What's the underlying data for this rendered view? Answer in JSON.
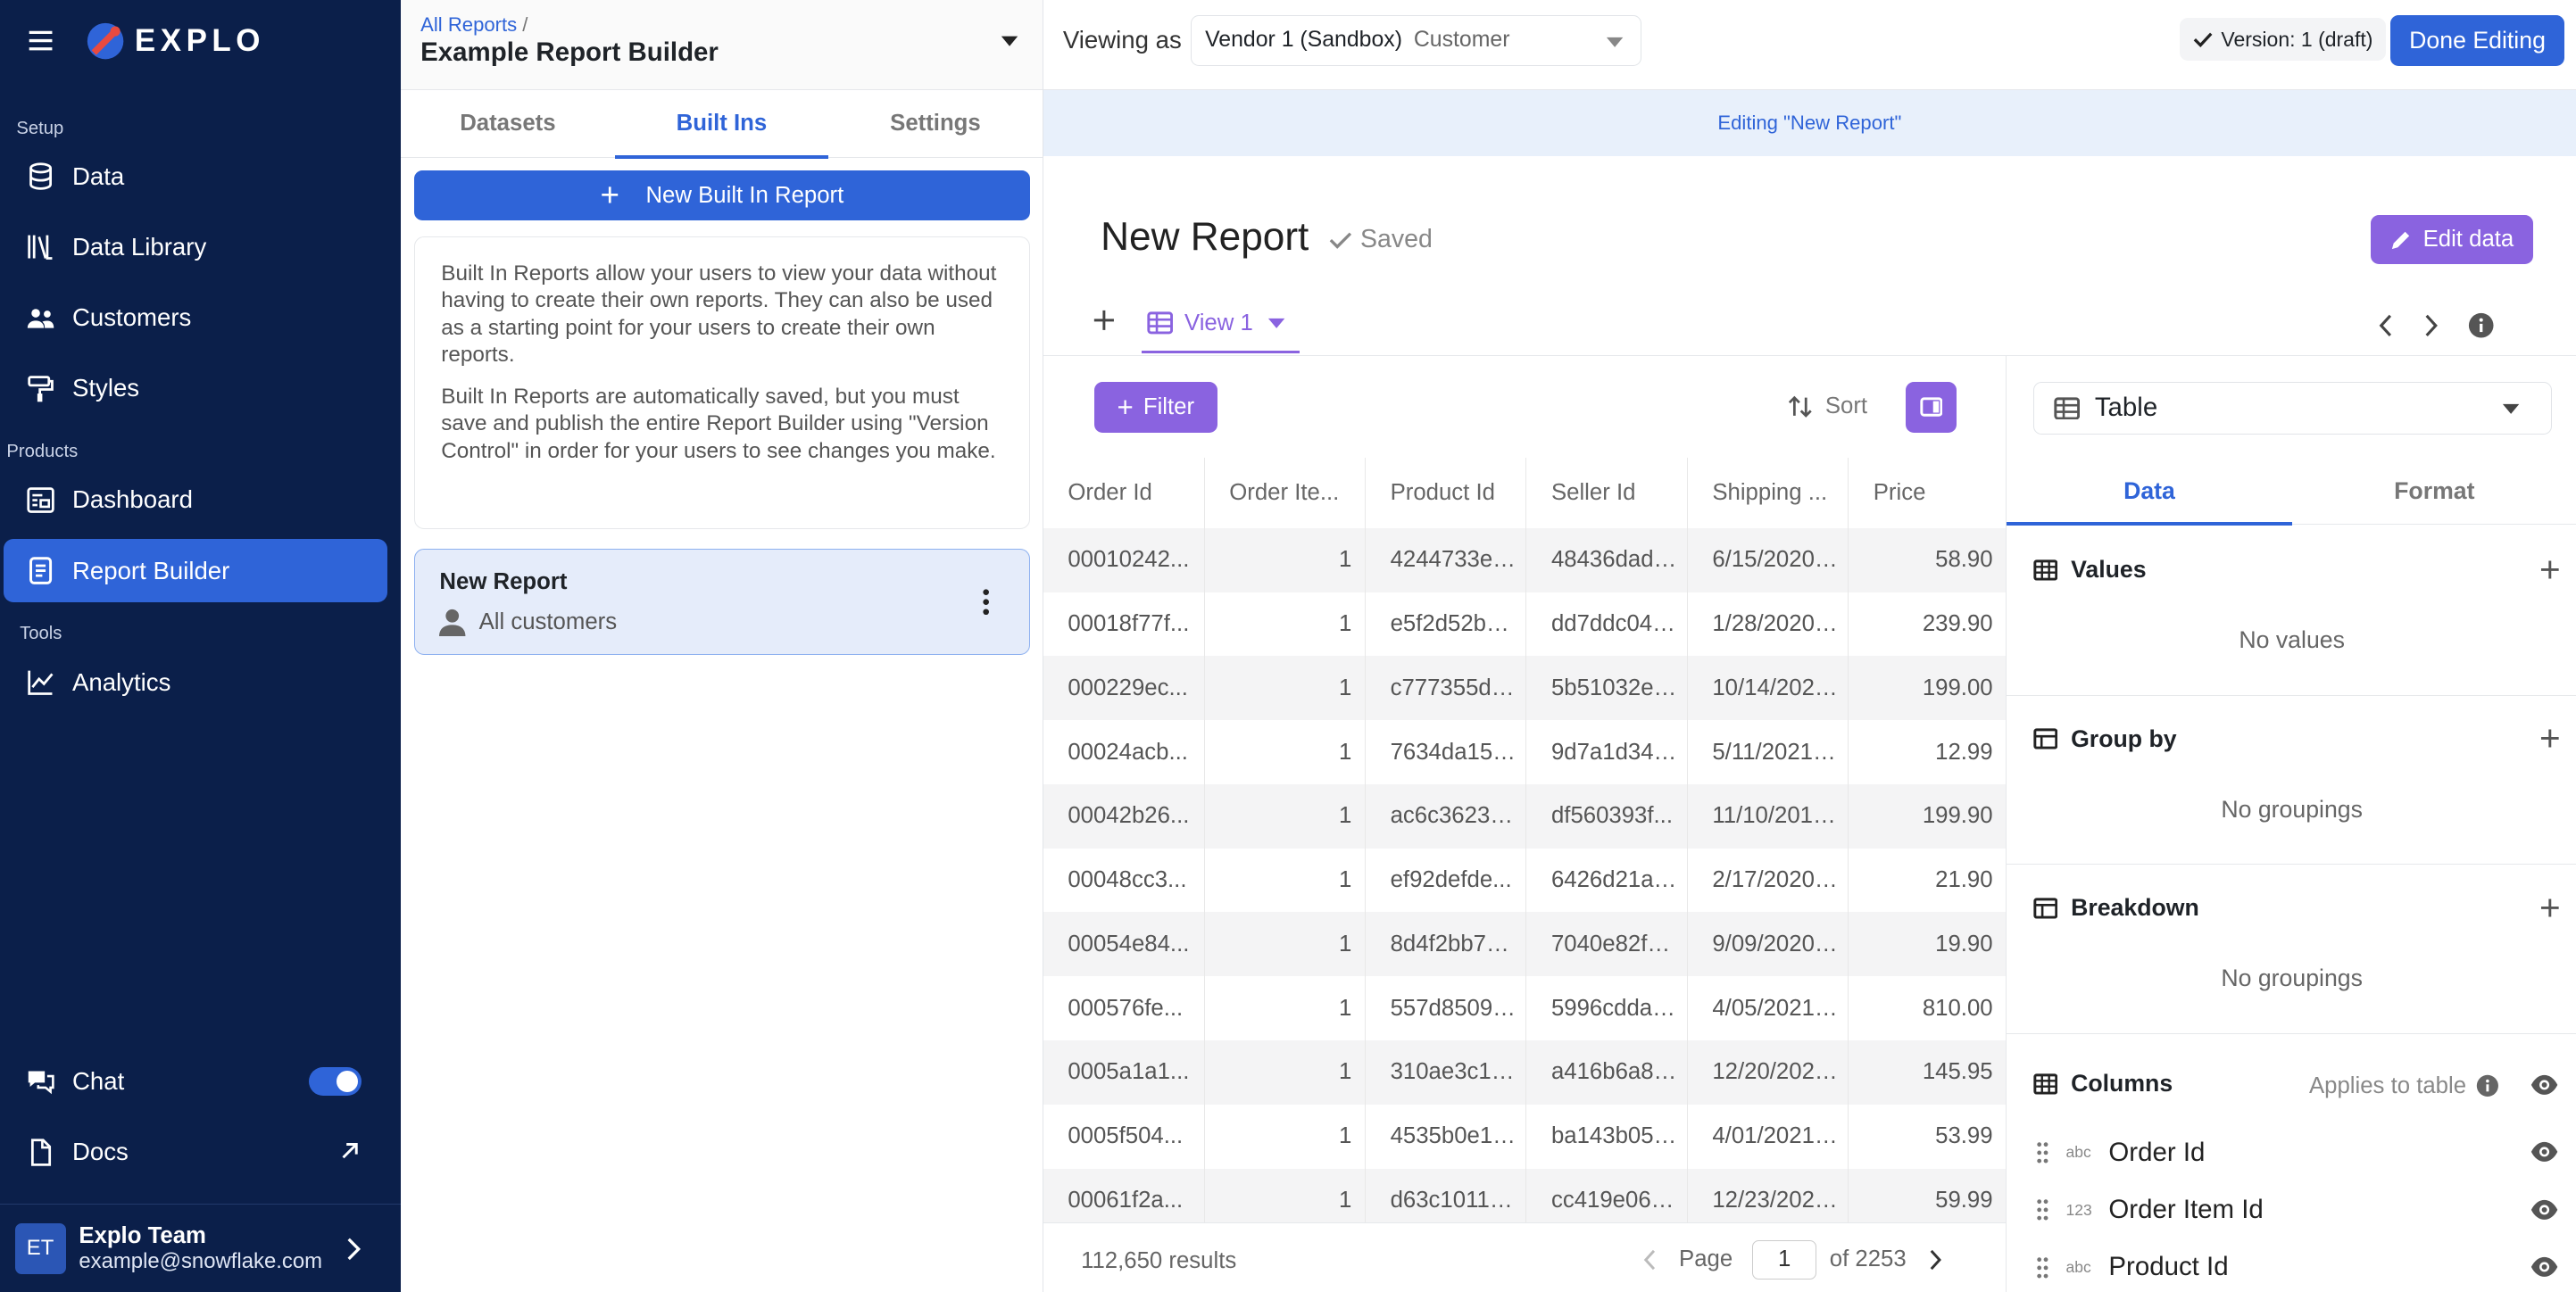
{
  "sidebar": {
    "logo_text": "EXPLO",
    "sections": {
      "setup": "Setup",
      "products": "Products",
      "tools": "Tools"
    },
    "items": [
      {
        "label": "Data",
        "icon": "database-icon"
      },
      {
        "label": "Data Library",
        "icon": "library-icon"
      },
      {
        "label": "Customers",
        "icon": "users-icon"
      },
      {
        "label": "Styles",
        "icon": "paint-roller-icon"
      },
      {
        "label": "Dashboard",
        "icon": "dashboard-icon"
      },
      {
        "label": "Report Builder",
        "icon": "report-icon",
        "active": true
      },
      {
        "label": "Analytics",
        "icon": "line-chart-icon"
      }
    ],
    "chat": {
      "label": "Chat",
      "enabled": true
    },
    "docs": {
      "label": "Docs"
    },
    "user": {
      "initials": "ET",
      "name": "Explo Team",
      "email": "example@snowflake.com"
    }
  },
  "builder": {
    "breadcrumb": "All Reports",
    "breadcrumb_sep": "/",
    "title": "Example Report Builder",
    "tabs": [
      "Datasets",
      "Built Ins",
      "Settings"
    ],
    "active_tab": "Built Ins",
    "new_button": "New Built In Report",
    "info_p1": "Built In Reports allow your users to view your data without having to create their own reports. They can also be used as a starting point for your users to create their own reports.",
    "info_p2": "Built In Reports are automatically saved, but you must save and publish the entire Report Builder using \"Version Control\" in order for your users to see changes you make.",
    "report_card": {
      "title": "New Report",
      "subtitle": "All customers"
    }
  },
  "topbar": {
    "viewing_as": "Viewing as",
    "vendor": "Vendor 1 (Sandbox)",
    "role": "Customer",
    "version": "Version: 1 (draft)",
    "done": "Done Editing"
  },
  "banner": "Editing \"New Report\"",
  "report": {
    "title": "New Report",
    "saved": "Saved",
    "edit_data": "Edit data",
    "view_tab": "View 1",
    "filter": "Filter",
    "sort": "Sort"
  },
  "table": {
    "headers": [
      "Order Id",
      "Order Ite...",
      "Product Id",
      "Seller Id",
      "Shipping ...",
      "Price"
    ],
    "rows": [
      [
        "00010242...",
        "1",
        "4244733e0...",
        "48436dade...",
        "6/15/2020, ...",
        "58.90"
      ],
      [
        "00018f77f...",
        "1",
        "e5f2d52b8...",
        "dd7ddc04e...",
        "1/28/2020, ...",
        "239.90"
      ],
      [
        "000229ec...",
        "1",
        "c777355d1...",
        "5b51032ed...",
        "10/14/2020...",
        "199.00"
      ],
      [
        "00024acb...",
        "1",
        "7634da152...",
        "9d7a1d34a...",
        "5/11/2021, 1...",
        "12.99"
      ],
      [
        "00042b26...",
        "1",
        "ac6c36230...",
        "df560393f...",
        "11/10/2019, ...",
        "199.90"
      ],
      [
        "00048cc3...",
        "1",
        "ef92defde...",
        "6426d21ac...",
        "2/17/2020, ...",
        "21.90"
      ],
      [
        "00054e84...",
        "1",
        "8d4f2bb7e...",
        "7040e82f8...",
        "9/09/2020,...",
        "19.90"
      ],
      [
        "000576fe...",
        "1",
        "557d85097...",
        "5996cddab...",
        "4/05/2021, ...",
        "810.00"
      ],
      [
        "0005a1a1...",
        "1",
        "310ae3c14...",
        "a416b6a84...",
        "12/20/2020...",
        "145.95"
      ],
      [
        "0005f504...",
        "1",
        "4535b0e10...",
        "ba143b05f...",
        "4/01/2021, 1...",
        "53.99"
      ],
      [
        "00061f2a...",
        "1",
        "d63c1011f4...",
        "cc419e065...",
        "12/23/2020...",
        "59.99"
      ]
    ],
    "results": "112,650 results",
    "page_label": "Page",
    "page": "1",
    "of": "of 2253"
  },
  "config": {
    "chart_type": "Table",
    "tabs": [
      "Data",
      "Format"
    ],
    "values": {
      "title": "Values",
      "empty": "No values"
    },
    "group_by": {
      "title": "Group by",
      "empty": "No groupings"
    },
    "breakdown": {
      "title": "Breakdown",
      "empty": "No groupings"
    },
    "columns": {
      "title": "Columns",
      "applies": "Applies to table",
      "items": [
        {
          "type": "abc",
          "name": "Order Id"
        },
        {
          "type": "123",
          "name": "Order Item Id"
        },
        {
          "type": "abc",
          "name": "Product Id"
        }
      ]
    }
  },
  "colors": {
    "sidebar": "#0b1f4a",
    "primary": "#2f64d8",
    "accent": "#8a63e0",
    "banner": "#e8f0fb"
  }
}
